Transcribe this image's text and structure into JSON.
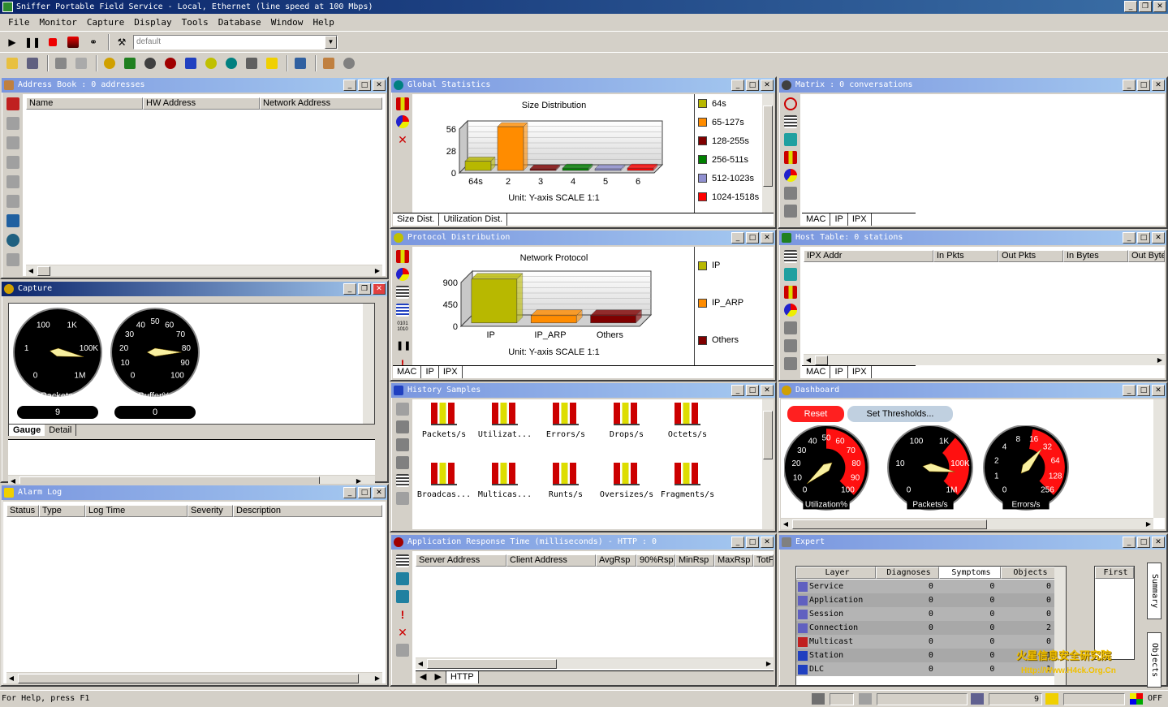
{
  "app": {
    "title": "Sniffer Portable Field Service - Local, Ethernet (line speed at 100 Mbps)"
  },
  "menu": [
    "File",
    "Monitor",
    "Capture",
    "Display",
    "Tools",
    "Database",
    "Window",
    "Help"
  ],
  "toolbar": {
    "filter_value": "default"
  },
  "address_book": {
    "title": "Address Book : 0 addresses",
    "columns": [
      "Name",
      "HW Address",
      "Network Address"
    ]
  },
  "global_stats": {
    "title": "Global Statistics",
    "chart_title": "Size Distribution",
    "unit": "Unit: Y-axis SCALE 1:1",
    "tabs": [
      "Size Dist.",
      "Utilization Dist."
    ],
    "legend": [
      {
        "label": "64s",
        "color": "#b8b800"
      },
      {
        "label": "65-127s",
        "color": "#ff8c00"
      },
      {
        "label": "128-255s",
        "color": "#800000"
      },
      {
        "label": "256-511s",
        "color": "#008000"
      },
      {
        "label": "512-1023s",
        "color": "#9090d0"
      },
      {
        "label": "1024-1518s",
        "color": "#ff0000"
      }
    ]
  },
  "matrix": {
    "title": "Matrix : 0 conversations",
    "tabs": [
      "MAC",
      "IP",
      "IPX"
    ]
  },
  "protocol": {
    "title": "Protocol Distribution",
    "chart_title": "Network Protocol",
    "unit": "Unit: Y-axis SCALE 1:1",
    "tabs": [
      "MAC",
      "IP",
      "IPX"
    ],
    "legend": [
      {
        "label": "IP",
        "color": "#b8b800"
      },
      {
        "label": "IP_ARP",
        "color": "#ff8c00"
      },
      {
        "label": "Others",
        "color": "#800000"
      }
    ]
  },
  "host_table": {
    "title": "Host Table: 0 stations",
    "columns": [
      "IPX Addr",
      "In Pkts",
      "Out Pkts",
      "In Bytes",
      "Out Byte"
    ],
    "tabs": [
      "MAC",
      "IP",
      "IPX"
    ]
  },
  "capture": {
    "title": "Capture",
    "packets_label": "Packets",
    "packets_value": "9",
    "buffer_label": "Buffer%",
    "buffer_value": "0",
    "tabs": [
      "Gauge",
      "Detail"
    ],
    "g1_ticks": [
      "100",
      "1K",
      "100K",
      "1M",
      "0",
      "1"
    ],
    "g2_ticks": [
      "40",
      "50",
      "60",
      "30",
      "70",
      "20",
      "80",
      "10",
      "90",
      "0",
      "100"
    ]
  },
  "history": {
    "title": "History Samples",
    "items": [
      "Packets/s",
      "Utilizat...",
      "Errors/s",
      "Drops/s",
      "Octets/s",
      "Broadcas...",
      "Multicas...",
      "Runts/s",
      "Oversizes/s",
      "Fragments/s"
    ]
  },
  "dashboard": {
    "title": "Dashboard",
    "reset_label": "Reset",
    "thresholds_label": "Set Thresholds...",
    "gauges": [
      {
        "label": "Utilization%",
        "ticks": [
          "40",
          "50",
          "60",
          "30",
          "70",
          "20",
          "80",
          "10",
          "90",
          "0",
          "100"
        ]
      },
      {
        "label": "Packets/s",
        "ticks": [
          "100",
          "1K",
          "10",
          "100K",
          "0",
          "1M"
        ]
      },
      {
        "label": "Errors/s",
        "ticks": [
          "4",
          "8",
          "16",
          "2",
          "32",
          "1",
          "64",
          "128",
          "0",
          "256"
        ]
      }
    ]
  },
  "alarm_log": {
    "title": "Alarm Log",
    "columns": [
      "Status",
      "Type",
      "Log Time",
      "Severity",
      "Description"
    ]
  },
  "app_response": {
    "title": "Application Response Time (milliseconds) - HTTP : 0",
    "columns": [
      "Server Address",
      "Client Address",
      "AvgRsp",
      "90%Rsp",
      "MinRsp",
      "MaxRsp",
      "TotF"
    ],
    "tabs": [
      "HTTP"
    ]
  },
  "expert": {
    "title": "Expert",
    "columns": [
      "Layer",
      "Diagnoses",
      "Symptoms",
      "Objects"
    ],
    "first_label": "First",
    "side_tabs": [
      "Summary",
      "Objects"
    ],
    "rows": [
      {
        "layer": "Service",
        "d": "0",
        "s": "0",
        "o": "0"
      },
      {
        "layer": "Application",
        "d": "0",
        "s": "0",
        "o": "0"
      },
      {
        "layer": "Session",
        "d": "0",
        "s": "0",
        "o": "0"
      },
      {
        "layer": "Connection",
        "d": "0",
        "s": "0",
        "o": "2"
      },
      {
        "layer": "Multicast",
        "d": "0",
        "s": "0",
        "o": "0"
      },
      {
        "layer": "Station",
        "d": "0",
        "s": "0",
        "o": "1"
      },
      {
        "layer": "DLC",
        "d": "0",
        "s": "0",
        "o": "1"
      }
    ]
  },
  "status": {
    "help_text": "For Help, press F1",
    "count": "9",
    "off_label": "OFF"
  },
  "watermark": {
    "line1": "火星信息安全研究院",
    "line2": "Http://Www.H4ck.Org.Cn"
  },
  "chart_data": [
    {
      "type": "bar",
      "title": "Size Distribution",
      "categories": [
        "64s",
        "2",
        "3",
        "4",
        "5",
        "6"
      ],
      "values": [
        12,
        56,
        2,
        3,
        2,
        3
      ],
      "ylim": [
        0,
        56
      ],
      "yticks": [
        "0",
        "28",
        "56"
      ],
      "xlabel": "",
      "ylabel": ""
    },
    {
      "type": "bar",
      "title": "Network Protocol",
      "categories": [
        "IP",
        "IP_ARP",
        "Others"
      ],
      "values": [
        900,
        150,
        150
      ],
      "ylim": [
        0,
        900
      ],
      "yticks": [
        "0",
        "450",
        "900"
      ],
      "xlabel": "",
      "ylabel": ""
    }
  ]
}
